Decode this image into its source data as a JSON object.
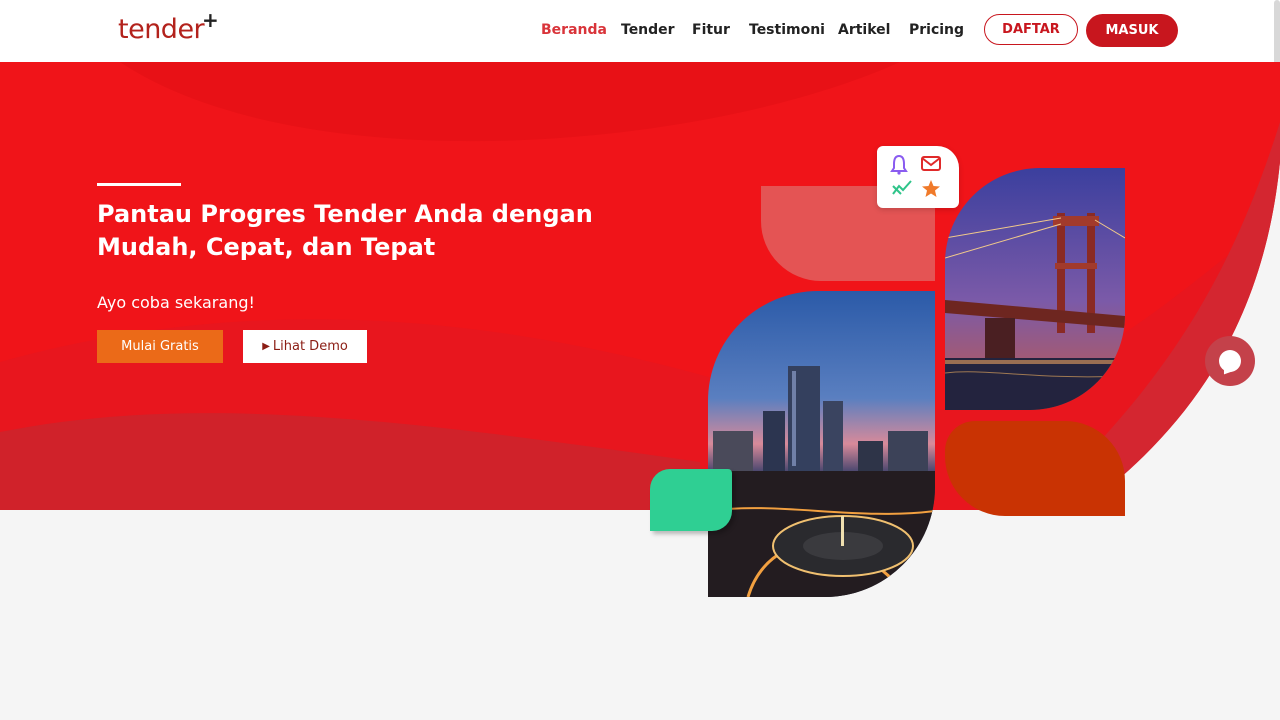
{
  "brand": {
    "name": "tender",
    "plus": "+"
  },
  "nav": {
    "links": [
      {
        "label": "Beranda",
        "active": true
      },
      {
        "label": "Tender",
        "active": false
      },
      {
        "label": "Fitur",
        "active": false
      },
      {
        "label": "Testimoni",
        "active": false
      },
      {
        "label": "Artikel",
        "active": false
      },
      {
        "label": "Pricing",
        "active": false
      }
    ],
    "daftar_label": "DAFTAR",
    "masuk_label": "MASUK"
  },
  "hero": {
    "title_line1": "Pantau Progres Tender Anda dengan",
    "title_line2": "Mudah, Cepat, dan Tepat",
    "subtitle": "Ayo coba sekarang!",
    "cta_primary": "Mulai Gratis",
    "cta_secondary": "Lihat Demo"
  },
  "icons": [
    "bell-icon",
    "mail-icon",
    "chart-trend-icon",
    "star-icon",
    "play-icon",
    "chat-icon"
  ],
  "colors": {
    "brand_red": "#c8161e",
    "hero_red": "#f01419",
    "orange": "#eb6a18",
    "green": "#2fcf93",
    "tile_orange": "#c93303"
  }
}
